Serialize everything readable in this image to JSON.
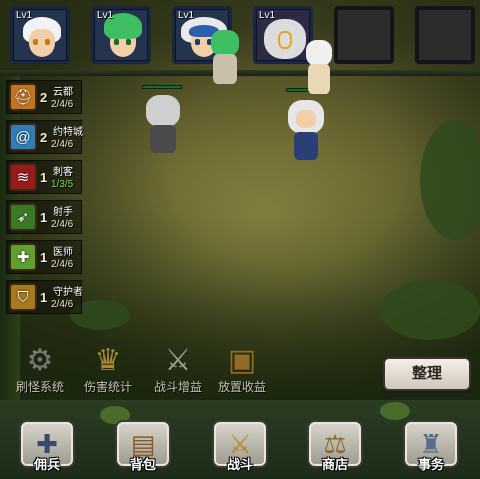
{
  "heroes": [
    {
      "level": "Lv1",
      "hair": "#ffffff",
      "frame": "#24344f"
    },
    {
      "level": "Lv1",
      "hair": "#3fbf63",
      "frame": "#24344f"
    },
    {
      "level": "Lv1",
      "hair": "#2a5fb0",
      "frame": "#24344f"
    },
    {
      "level": "Lv1",
      "hair": "#e8e8e8",
      "frame": "#2c2a45"
    },
    {
      "level": "",
      "empty": true
    },
    {
      "level": "",
      "empty": true
    }
  ],
  "factions": [
    {
      "name": "云都",
      "count": "2",
      "progress": "2/4/6",
      "progress_color": "#f0e6c0",
      "icon": "helmet-icon",
      "icon_bg": "#c4741e"
    },
    {
      "name": "约特城",
      "count": "2",
      "progress": "2/4/6",
      "progress_color": "#f0e6c0",
      "icon": "swirl-icon",
      "icon_bg": "#2e7fb8"
    },
    {
      "name": "刺客",
      "count": "1",
      "progress": "1/3/5",
      "progress_color": "#6fdc5a",
      "icon": "claw-icon",
      "icon_bg": "#9a1a1a"
    },
    {
      "name": "射手",
      "count": "1",
      "progress": "2/4/6",
      "progress_color": "#f0e6c0",
      "icon": "arrow-icon",
      "icon_bg": "#3b7a25"
    },
    {
      "name": "医师",
      "count": "1",
      "progress": "2/4/6",
      "progress_color": "#f0e6c0",
      "icon": "heal-icon",
      "icon_bg": "#5fa02e"
    },
    {
      "name": "守护者",
      "count": "1",
      "progress": "2/4/6",
      "progress_color": "#f0e6c0",
      "icon": "shield-icon",
      "icon_bg": "#a87a1e"
    }
  ],
  "utilities": [
    {
      "label": "刷怪系统",
      "icon": "gear-icon"
    },
    {
      "label": "伤害统计",
      "icon": "trophy-icon"
    },
    {
      "label": "战斗增益",
      "icon": "sword-icon"
    },
    {
      "label": "放置收益",
      "icon": "chest-icon"
    }
  ],
  "sort_button": "整理",
  "nav": [
    {
      "label": "佣兵",
      "icon": "helmet-icon"
    },
    {
      "label": "背包",
      "icon": "backpack-icon"
    },
    {
      "label": "战斗",
      "icon": "crossed-swords-icon"
    },
    {
      "label": "商店",
      "icon": "scales-icon"
    },
    {
      "label": "事务",
      "icon": "castle-icon"
    }
  ]
}
